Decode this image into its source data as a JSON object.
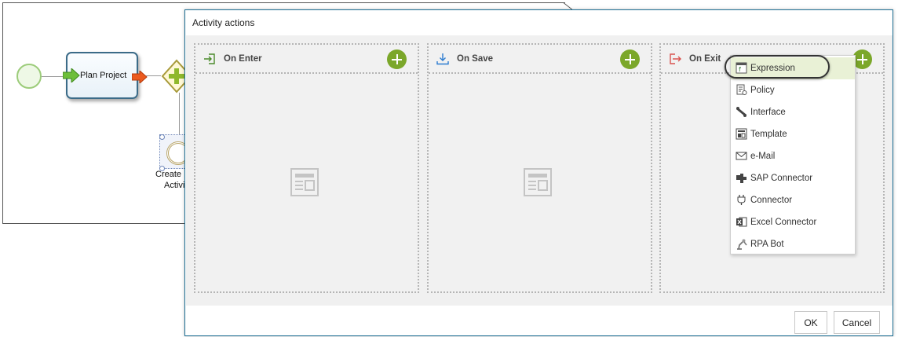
{
  "diagram": {
    "task_label": "Plan Project",
    "intermediate_label_line1": "Create",
    "intermediate_label_line2": "Activi"
  },
  "dialog": {
    "title": "Activity actions",
    "panels": [
      {
        "title": "On Enter",
        "icon": "enter-icon"
      },
      {
        "title": "On Save",
        "icon": "save-download-icon"
      },
      {
        "title": "On Exit",
        "icon": "exit-icon"
      }
    ],
    "ok_label": "OK",
    "cancel_label": "Cancel"
  },
  "menu": {
    "items": [
      {
        "label": "Expression",
        "icon": "expression-icon",
        "active": true
      },
      {
        "label": "Policy",
        "icon": "policy-icon"
      },
      {
        "label": "Interface",
        "icon": "interface-icon"
      },
      {
        "label": "Template",
        "icon": "template-icon"
      },
      {
        "label": "e-Mail",
        "icon": "email-icon"
      },
      {
        "label": "SAP Connector",
        "icon": "sap-connector-icon"
      },
      {
        "label": "Connector",
        "icon": "connector-icon"
      },
      {
        "label": "Excel Connector",
        "icon": "excel-icon"
      },
      {
        "label": "RPA Bot",
        "icon": "rpa-bot-icon"
      }
    ]
  },
  "colors": {
    "accent_green": "#7ba72a",
    "dialog_border": "#1e6f94",
    "menu_active": "#e9f1d6",
    "exit_red": "#d9534f",
    "save_blue": "#2b7bd0"
  }
}
